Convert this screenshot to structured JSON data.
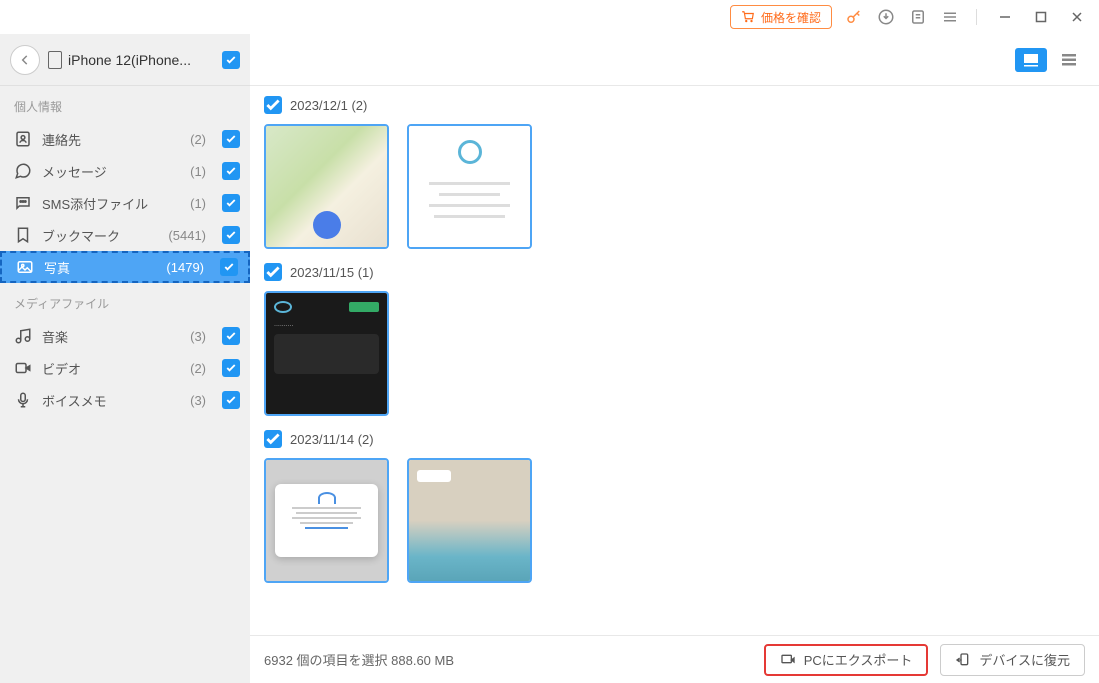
{
  "titlebar": {
    "price_check": "価格を確認"
  },
  "device": {
    "name": "iPhone 12(iPhone..."
  },
  "sections": {
    "personal": "個人情報",
    "media": "メディアファイル"
  },
  "categories": {
    "personal": [
      {
        "icon": "contact",
        "label": "連絡先",
        "count": "(2)"
      },
      {
        "icon": "message",
        "label": "メッセージ",
        "count": "(1)"
      },
      {
        "icon": "sms",
        "label": "SMS添付ファイル",
        "count": "(1)"
      },
      {
        "icon": "bookmark",
        "label": "ブックマーク",
        "count": "(5441)"
      },
      {
        "icon": "photo",
        "label": "写真",
        "count": "(1479)"
      }
    ],
    "media": [
      {
        "icon": "music",
        "label": "音楽",
        "count": "(3)"
      },
      {
        "icon": "video",
        "label": "ビデオ",
        "count": "(2)"
      },
      {
        "icon": "voice",
        "label": "ボイスメモ",
        "count": "(3)"
      }
    ]
  },
  "groups": [
    {
      "date": "2023/12/1 (2)",
      "thumbs": [
        "map1",
        "doc1"
      ]
    },
    {
      "date": "2023/11/15 (1)",
      "thumbs": [
        "dark1"
      ]
    },
    {
      "date": "2023/11/14 (2)",
      "thumbs": [
        "dialog",
        "map2"
      ]
    }
  ],
  "footer": {
    "status": "6932 個の項目を選択 888.60 MB",
    "export": "PCにエクスポート",
    "restore": "デバイスに復元"
  }
}
